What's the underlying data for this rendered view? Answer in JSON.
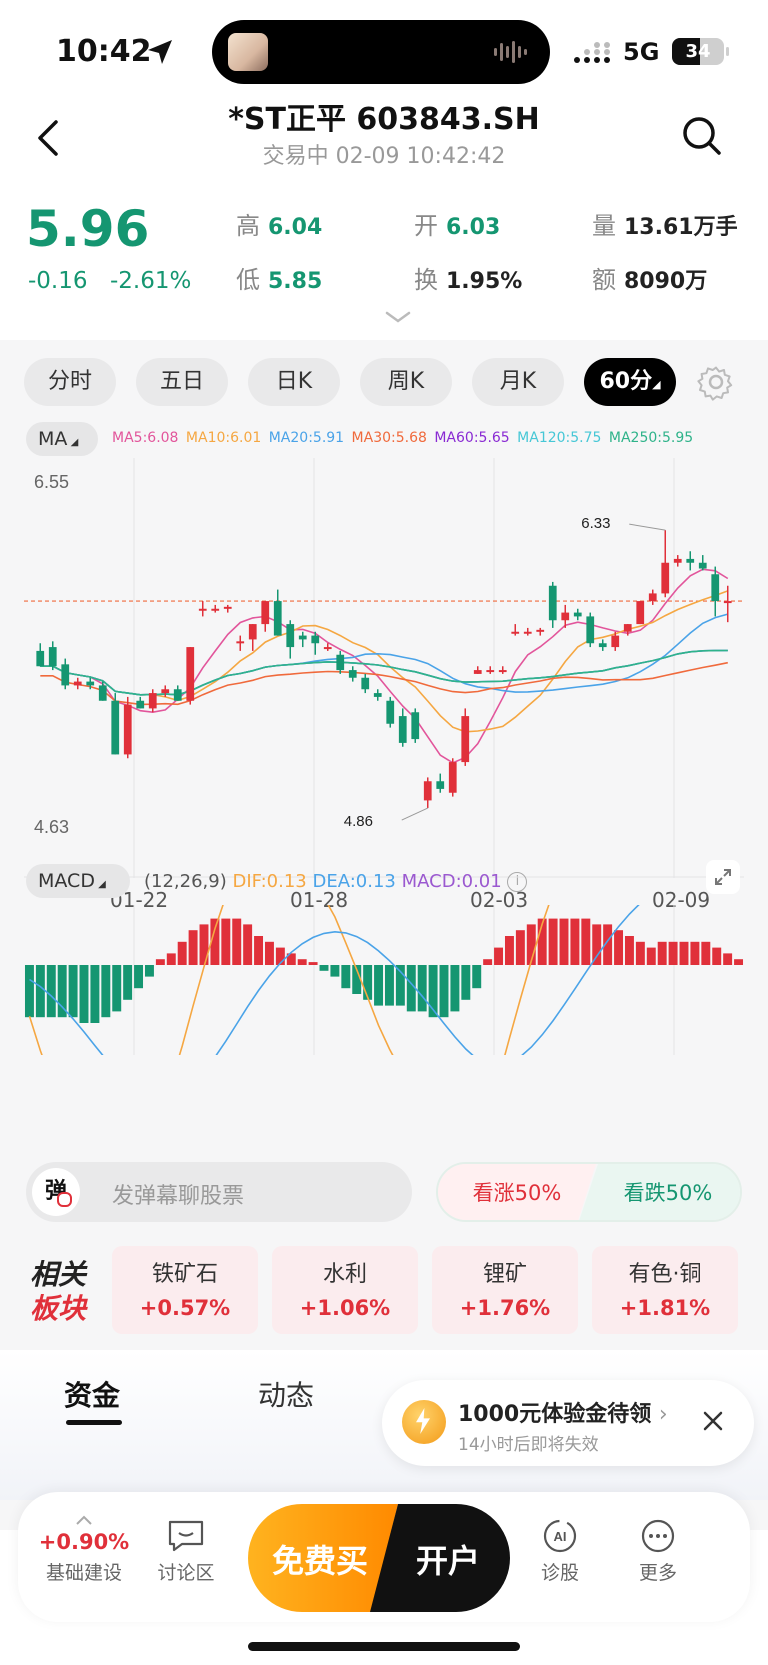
{
  "status_bar": {
    "time": "10:42",
    "network": "5G",
    "battery": "34"
  },
  "header": {
    "title": "*ST正平 603843.SH",
    "subtitle": "交易中 02-09 10:42:42"
  },
  "quote": {
    "price": "5.96",
    "change": "-0.16",
    "change_pct": "-2.61%",
    "high_label": "高",
    "high": "6.04",
    "open_label": "开",
    "open": "6.03",
    "volume_label": "量",
    "volume": "13.61万手",
    "low_label": "低",
    "low": "5.85",
    "turnover_label": "换",
    "turnover": "1.95%",
    "amount_label": "额",
    "amount": "8090万"
  },
  "period_tabs": [
    {
      "label": "分时"
    },
    {
      "label": "五日"
    },
    {
      "label": "日K"
    },
    {
      "label": "周K"
    },
    {
      "label": "月K"
    },
    {
      "label": "60分",
      "selected": true
    }
  ],
  "ma": {
    "label": "MA",
    "items": [
      {
        "text": "MA5:6.08",
        "color": "#e2559b"
      },
      {
        "text": "MA10:6.01",
        "color": "#f5a742"
      },
      {
        "text": "MA20:5.91",
        "color": "#4aa3e8"
      },
      {
        "text": "MA30:5.68",
        "color": "#f06a3c"
      },
      {
        "text": "MA60:5.65",
        "color": "#8a2bd3"
      },
      {
        "text": "MA120:5.75",
        "color": "#46c7d6"
      },
      {
        "text": "MA250:5.95",
        "color": "#2fb38a"
      }
    ]
  },
  "chart_labels": {
    "y_top": "6.55",
    "y_bottom": "4.63",
    "max_label": "6.33",
    "min_label": "4.86",
    "dates": [
      "01-22",
      "01-28",
      "02-03",
      "02-09"
    ]
  },
  "macd": {
    "label": "MACD",
    "params": "(12,26,9)",
    "dif": "DIF:0.13",
    "dea": "DEA:0.13",
    "macd": "MACD:0.01"
  },
  "chart_data": [
    {
      "type": "candlestick",
      "title": "",
      "ylim": [
        4.63,
        6.55
      ],
      "x_tick_labels": [
        "01-22",
        "01-28",
        "02-03",
        "02-09"
      ],
      "candles": [
        {
          "o": 5.7,
          "h": 5.74,
          "l": 5.62,
          "c": 5.62
        },
        {
          "o": 5.72,
          "h": 5.75,
          "l": 5.6,
          "c": 5.62
        },
        {
          "o": 5.63,
          "h": 5.66,
          "l": 5.5,
          "c": 5.52
        },
        {
          "o": 5.52,
          "h": 5.56,
          "l": 5.5,
          "c": 5.54
        },
        {
          "o": 5.54,
          "h": 5.56,
          "l": 5.5,
          "c": 5.52
        },
        {
          "o": 5.52,
          "h": 5.54,
          "l": 5.44,
          "c": 5.44
        },
        {
          "o": 5.44,
          "h": 5.48,
          "l": 5.16,
          "c": 5.16
        },
        {
          "o": 5.16,
          "h": 5.46,
          "l": 5.14,
          "c": 5.42
        },
        {
          "o": 5.44,
          "h": 5.46,
          "l": 5.4,
          "c": 5.4
        },
        {
          "o": 5.4,
          "h": 5.5,
          "l": 5.38,
          "c": 5.48
        },
        {
          "o": 5.48,
          "h": 5.52,
          "l": 5.46,
          "c": 5.5
        },
        {
          "o": 5.5,
          "h": 5.52,
          "l": 5.44,
          "c": 5.44
        },
        {
          "o": 5.44,
          "h": 5.72,
          "l": 5.42,
          "c": 5.72
        },
        {
          "o": 5.92,
          "h": 5.96,
          "l": 5.88,
          "c": 5.92
        },
        {
          "o": 5.92,
          "h": 5.94,
          "l": 5.9,
          "c": 5.92
        },
        {
          "o": 5.92,
          "h": 5.94,
          "l": 5.9,
          "c": 5.93
        },
        {
          "o": 5.74,
          "h": 5.78,
          "l": 5.7,
          "c": 5.75
        },
        {
          "o": 5.76,
          "h": 5.84,
          "l": 5.7,
          "c": 5.84
        },
        {
          "o": 5.84,
          "h": 5.96,
          "l": 5.8,
          "c": 5.96
        },
        {
          "o": 5.96,
          "h": 6.02,
          "l": 5.78,
          "c": 5.78
        },
        {
          "o": 5.84,
          "h": 5.86,
          "l": 5.66,
          "c": 5.72
        },
        {
          "o": 5.78,
          "h": 5.8,
          "l": 5.72,
          "c": 5.76
        },
        {
          "o": 5.78,
          "h": 5.8,
          "l": 5.68,
          "c": 5.74
        },
        {
          "o": 5.72,
          "h": 5.74,
          "l": 5.7,
          "c": 5.72
        },
        {
          "o": 5.68,
          "h": 5.7,
          "l": 5.58,
          "c": 5.6
        },
        {
          "o": 5.6,
          "h": 5.62,
          "l": 5.54,
          "c": 5.56
        },
        {
          "o": 5.56,
          "h": 5.58,
          "l": 5.48,
          "c": 5.5
        },
        {
          "o": 5.48,
          "h": 5.5,
          "l": 5.44,
          "c": 5.46
        },
        {
          "o": 5.44,
          "h": 5.46,
          "l": 5.3,
          "c": 5.32
        },
        {
          "o": 5.36,
          "h": 5.4,
          "l": 5.2,
          "c": 5.22
        },
        {
          "o": 5.38,
          "h": 5.4,
          "l": 5.22,
          "c": 5.24
        },
        {
          "o": 4.92,
          "h": 5.04,
          "l": 4.88,
          "c": 5.02
        },
        {
          "o": 5.02,
          "h": 5.06,
          "l": 4.96,
          "c": 4.98
        },
        {
          "o": 4.96,
          "h": 5.14,
          "l": 4.94,
          "c": 5.12
        },
        {
          "o": 5.12,
          "h": 5.4,
          "l": 5.1,
          "c": 5.36
        },
        {
          "o": 5.58,
          "h": 5.62,
          "l": 5.58,
          "c": 5.6
        },
        {
          "o": 5.6,
          "h": 5.62,
          "l": 5.58,
          "c": 5.6
        },
        {
          "o": 5.6,
          "h": 5.62,
          "l": 5.58,
          "c": 5.6
        },
        {
          "o": 5.8,
          "h": 5.84,
          "l": 5.78,
          "c": 5.8
        },
        {
          "o": 5.8,
          "h": 5.82,
          "l": 5.78,
          "c": 5.8
        },
        {
          "o": 5.8,
          "h": 5.82,
          "l": 5.78,
          "c": 5.81
        },
        {
          "o": 6.04,
          "h": 6.06,
          "l": 5.82,
          "c": 5.86
        },
        {
          "o": 5.86,
          "h": 5.94,
          "l": 5.82,
          "c": 5.9
        },
        {
          "o": 5.9,
          "h": 5.92,
          "l": 5.86,
          "c": 5.88
        },
        {
          "o": 5.88,
          "h": 5.9,
          "l": 5.72,
          "c": 5.74
        },
        {
          "o": 5.74,
          "h": 5.76,
          "l": 5.7,
          "c": 5.72
        },
        {
          "o": 5.72,
          "h": 5.8,
          "l": 5.7,
          "c": 5.78
        },
        {
          "o": 5.8,
          "h": 5.84,
          "l": 5.78,
          "c": 5.84
        },
        {
          "o": 5.84,
          "h": 5.96,
          "l": 5.84,
          "c": 5.96
        },
        {
          "o": 5.96,
          "h": 6.02,
          "l": 5.94,
          "c": 6.0
        },
        {
          "o": 6.0,
          "h": 6.33,
          "l": 5.98,
          "c": 6.16
        },
        {
          "o": 6.16,
          "h": 6.2,
          "l": 6.14,
          "c": 6.18
        },
        {
          "o": 6.18,
          "h": 6.22,
          "l": 6.12,
          "c": 6.16
        },
        {
          "o": 6.16,
          "h": 6.2,
          "l": 6.12,
          "c": 6.13
        },
        {
          "o": 6.1,
          "h": 6.14,
          "l": 5.88,
          "c": 5.96
        },
        {
          "o": 5.96,
          "h": 6.04,
          "l": 5.85,
          "c": 5.96
        }
      ]
    },
    {
      "type": "bar",
      "title": "MACD",
      "series": [
        {
          "name": "MACD",
          "values": [
            -0.09,
            -0.09,
            -0.09,
            -0.09,
            -0.09,
            -0.1,
            -0.1,
            -0.09,
            -0.08,
            -0.06,
            -0.04,
            -0.02,
            0.01,
            0.02,
            0.04,
            0.06,
            0.07,
            0.08,
            0.08,
            0.08,
            0.07,
            0.05,
            0.04,
            0.03,
            0.02,
            0.01,
            0.005,
            -0.01,
            -0.02,
            -0.04,
            -0.05,
            -0.06,
            -0.07,
            -0.07,
            -0.07,
            -0.08,
            -0.08,
            -0.09,
            -0.09,
            -0.08,
            -0.06,
            -0.04,
            0.01,
            0.03,
            0.05,
            0.06,
            0.07,
            0.08,
            0.08,
            0.08,
            0.08,
            0.08,
            0.07,
            0.07,
            0.06,
            0.05,
            0.04,
            0.03,
            0.04,
            0.04,
            0.04,
            0.04,
            0.04,
            0.03,
            0.02,
            0.01
          ]
        }
      ],
      "ylim": [
        -0.1,
        0.1
      ]
    }
  ],
  "danmu": {
    "icon_text": "弹",
    "placeholder": "发弹幕聊股票"
  },
  "vote": {
    "up": "看涨50%",
    "down": "看跌50%"
  },
  "related": {
    "title_line1": "相关",
    "title_line2": "板块",
    "sectors": [
      {
        "name": "铁矿石",
        "pct": "+0.57%"
      },
      {
        "name": "水利",
        "pct": "+1.06%"
      },
      {
        "name": "锂矿",
        "pct": "+1.76%"
      },
      {
        "name": "有色·铜",
        "pct": "+1.81%"
      }
    ]
  },
  "bottom_tabs": {
    "tab1": "资金",
    "tab2": "动态"
  },
  "promo": {
    "title": "1000元体验金待领",
    "subtitle": "14小时后即将失效"
  },
  "bottom_bar": {
    "index_pct": "+0.90%",
    "index_name": "基础建设",
    "discuss": "讨论区",
    "buy": "免费买",
    "open": "开户",
    "diagnose": "诊股",
    "more": "更多"
  }
}
